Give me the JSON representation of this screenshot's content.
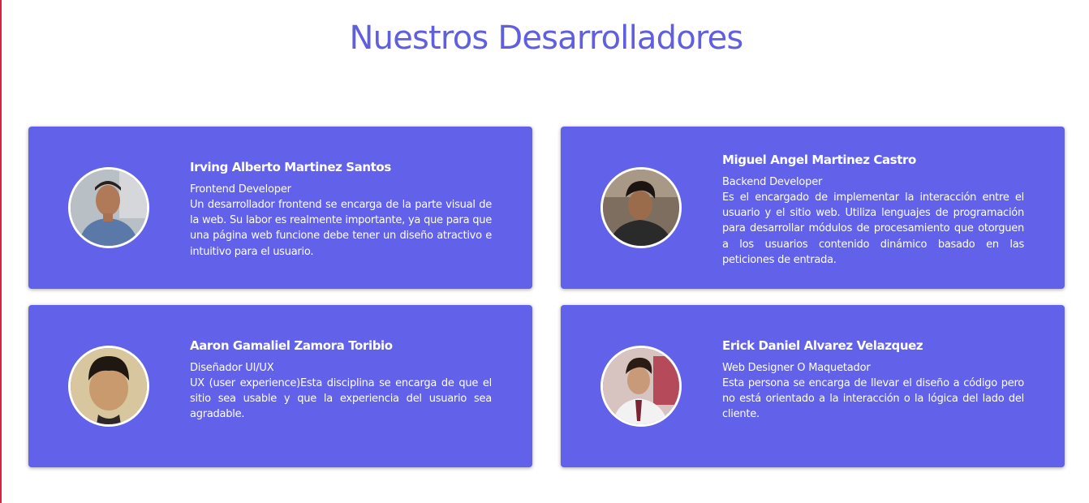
{
  "page": {
    "title": "Nuestros Desarrolladores"
  },
  "colors": {
    "accent": "#5f5fdf",
    "card_bg": "#6161e9",
    "text_on_card": "#ffffff",
    "left_edge": "#d9223a"
  },
  "developers": [
    {
      "name": "Irving Alberto Martinez Santos",
      "role": "Frontend Developer",
      "description": "Un desarrollador frontend se encarga de la parte visual de la web. Su labor es realmente importante, ya que para que una página web funcione debe tener un diseño atractivo e intuitivo para el usuario.",
      "photo": "developer-photo"
    },
    {
      "name": "Miguel Angel Martinez Castro",
      "role": "Backend Developer",
      "description": "Es el encargado de implementar la interacción entre el usuario y el sitio web. Utiliza lenguajes de programación para desarrollar módulos de procesamiento que otorguen a los usuarios contenido dinámico basado en las peticiones de entrada.",
      "photo": "developer-photo"
    },
    {
      "name": "Aaron Gamaliel Zamora Toribio",
      "role": "Diseñador UI/UX",
      "description": "UX (user experience)Esta disciplina se encarga de que el sitio sea usable y que la experiencia del usuario sea agradable.",
      "photo": "developer-photo"
    },
    {
      "name": "Erick Daniel Alvarez Velazquez",
      "role": "Web Designer O Maquetador",
      "description": "Esta persona se encarga de llevar el diseño a código pero no está orientado a la interacción o la lógica del lado del cliente.",
      "photo": "developer-photo"
    }
  ]
}
